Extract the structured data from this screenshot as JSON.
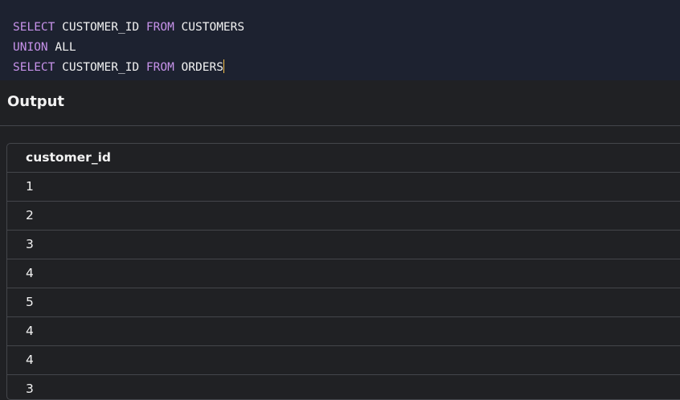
{
  "editor": {
    "lines": [
      {
        "kw1": "SELECT",
        "t1": " CUSTOMER_ID ",
        "kw2": "FROM",
        "t2": " CUSTOMERS"
      },
      {
        "kw1": "UNION",
        "t1": " ALL",
        "kw2": "",
        "t2": ""
      },
      {
        "kw1": "SELECT",
        "t1": " CUSTOMER_ID ",
        "kw2": "FROM",
        "t2": " ORDERS"
      }
    ]
  },
  "output": {
    "title": "Output",
    "columns": [
      "customer_id"
    ],
    "rows": [
      "1",
      "2",
      "3",
      "4",
      "5",
      "4",
      "4",
      "3"
    ]
  },
  "colors": {
    "editor_bg": "#1d2230",
    "keyword": "#c792ea",
    "cursor": "#f5c04a",
    "panel_bg": "#202124",
    "border": "#44464b"
  }
}
